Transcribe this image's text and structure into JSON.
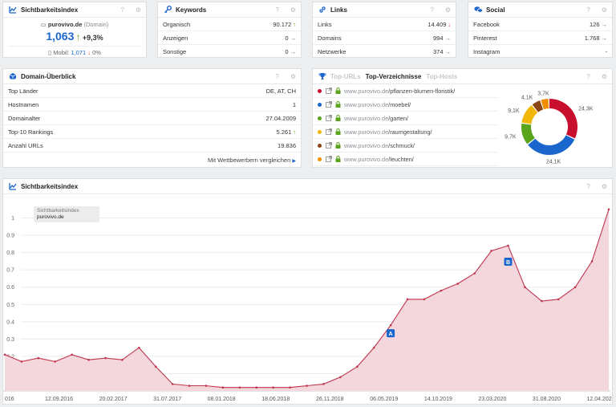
{
  "colors": {
    "accent": "#1a66cc",
    "up": "#5aa31c",
    "down": "#d8332a",
    "chart_fill": "#f3d7dd",
    "chart_line": "#c0364d"
  },
  "si_card": {
    "title": "Sichtbarkeitsindex",
    "domain": "purovivo.de",
    "domain_suffix": "(Domain)",
    "value": "1,063",
    "change": "+9,3%",
    "mobile_label": "Mobil:",
    "mobile_value": "1,071",
    "mobile_change": "0%"
  },
  "keywords_card": {
    "title": "Keywords",
    "rows": [
      {
        "label": "Organisch",
        "value": "90.172"
      },
      {
        "label": "Anzeigen",
        "value": "0"
      },
      {
        "label": "Sonstige",
        "value": "0"
      }
    ]
  },
  "links_card": {
    "title": "Links",
    "rows": [
      {
        "label": "Links",
        "value": "14.409"
      },
      {
        "label": "Domains",
        "value": "994"
      },
      {
        "label": "Netzwerke",
        "value": "374"
      }
    ]
  },
  "social_card": {
    "title": "Social",
    "rows": [
      {
        "label": "Facebook",
        "value": "126"
      },
      {
        "label": "Pinterest",
        "value": "1.768"
      },
      {
        "label": "Instagram",
        "value": "-"
      }
    ]
  },
  "overview_card": {
    "title": "Domain-Überblick",
    "rows": [
      {
        "label": "Top Länder",
        "value": "DE, AT, CH"
      },
      {
        "label": "Hostnamen",
        "value": "1"
      },
      {
        "label": "Domainalter",
        "value": "27.04.2009"
      },
      {
        "label": "Top-10 Rankings",
        "value": "5.261"
      },
      {
        "label": "Anzahl URLs",
        "value": "19.836"
      }
    ],
    "compare_link": "Mit Wettbewerbern vergleichen"
  },
  "dirs_card": {
    "tabs": [
      "Top-URLs",
      "Top-Verzeichnisse",
      "Top-Hosts"
    ],
    "active_tab": 1,
    "host": "www.purovivo.de",
    "items": [
      {
        "path": "/pflanzen-blumen-floristik/",
        "color": "#c8102e"
      },
      {
        "path": "/moebel/",
        "color": "#1a66cc"
      },
      {
        "path": "/garten/",
        "color": "#5aa31c"
      },
      {
        "path": "/raumgestaltung/",
        "color": "#f2b705"
      },
      {
        "path": "/schmuck/",
        "color": "#8b4513"
      },
      {
        "path": "/leuchten/",
        "color": "#f28c00"
      }
    ],
    "donut": {
      "values": [
        24.3,
        24.1,
        9.7,
        9.1,
        4.1,
        3.7
      ],
      "labels": [
        "24,3K",
        "24,1K",
        "9,7K",
        "9,1K",
        "4,1K",
        "3,7K"
      ]
    }
  },
  "chart_card": {
    "title": "Sichtbarkeitsindex",
    "tooltip_title": "Sichtbarkeitsindex",
    "tooltip_value": "purovivo.de",
    "markers": [
      {
        "label": "A",
        "x": "13.03.2020"
      },
      {
        "label": "B",
        "x": "23.10.2020"
      }
    ]
  },
  "chart_data": {
    "type": "area",
    "title": "Sichtbarkeitsindex",
    "ylim": [
      0,
      1.1
    ],
    "yticks": [
      "0.1",
      "0.2",
      "0.3",
      "0.4",
      "0.5",
      "0.6",
      "0.7",
      "0.8",
      "0.9",
      "1"
    ],
    "xticks": [
      "016",
      "12.09.2016",
      "20.02.2017",
      "31.07.2017",
      "08.01.2018",
      "18.06.2018",
      "26.11.2018",
      "06.05.2019",
      "14.10.2019",
      "23.03.2020",
      "31.08.2020",
      "12.04.2021"
    ],
    "series": [
      {
        "name": "purovivo.de",
        "x": [
          "2016-04",
          "2016-06",
          "2016-08",
          "2016-10",
          "2016-12",
          "2017-02",
          "2017-04",
          "2017-05",
          "2017-06",
          "2017-07",
          "2017-08",
          "2017-10",
          "2018-01",
          "2018-04",
          "2018-07",
          "2018-10",
          "2019-01",
          "2019-04",
          "2019-07",
          "2019-09",
          "2019-11",
          "2020-01",
          "2020-02",
          "2020-03",
          "2020-04",
          "2020-05",
          "2020-06",
          "2020-07",
          "2020-08",
          "2020-09",
          "2020-10",
          "2020-11",
          "2020-12",
          "2021-01",
          "2021-02",
          "2021-03",
          "2021-04"
        ],
        "values": [
          0.21,
          0.17,
          0.19,
          0.17,
          0.21,
          0.18,
          0.19,
          0.18,
          0.25,
          0.14,
          0.04,
          0.03,
          0.03,
          0.02,
          0.02,
          0.02,
          0.02,
          0.02,
          0.03,
          0.04,
          0.08,
          0.14,
          0.25,
          0.38,
          0.53,
          0.53,
          0.58,
          0.62,
          0.68,
          0.81,
          0.84,
          0.6,
          0.52,
          0.53,
          0.6,
          0.75,
          1.05
        ]
      }
    ]
  }
}
